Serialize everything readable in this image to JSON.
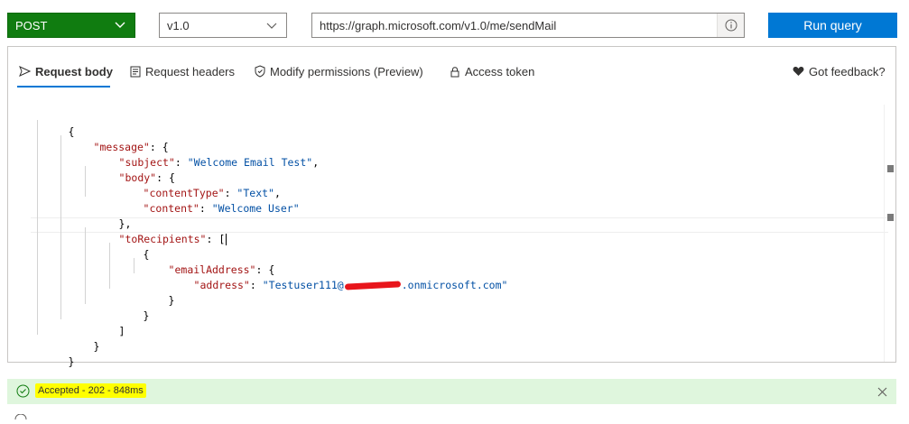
{
  "toolbar": {
    "method": "POST",
    "method_icon": "chevron-down-icon",
    "version": "v1.0",
    "url": "https://graph.microsoft.com/v1.0/me/sendMail",
    "url_info_icon": "info-icon",
    "run_label": "Run query"
  },
  "tabs": [
    {
      "label": "Request body",
      "icon": "send-icon",
      "active": true
    },
    {
      "label": "Request headers",
      "icon": "document-icon",
      "active": false
    },
    {
      "label": "Modify permissions (Preview)",
      "icon": "shield-icon",
      "active": false
    },
    {
      "label": "Access token",
      "icon": "lock-icon",
      "active": false
    }
  ],
  "feedback_label": "Got feedback?",
  "editor": {
    "l1": "{",
    "l2_key": "\"message\"",
    "l2_rest": ": {",
    "l3_key": "\"subject\"",
    "l3_sep": ": ",
    "l3_val": "\"Welcome Email Test\"",
    "l3_end": ",",
    "l4_key": "\"body\"",
    "l4_rest": ": {",
    "l5_key": "\"contentType\"",
    "l5_sep": ": ",
    "l5_val": "\"Text\"",
    "l5_end": ",",
    "l6_key": "\"content\"",
    "l6_sep": ": ",
    "l6_val": "\"Welcome User\"",
    "l7": "},",
    "l8_key": "\"toRecipients\"",
    "l8_rest": ": [",
    "l9": "{",
    "l10_key": "\"emailAddress\"",
    "l10_rest": ": {",
    "l11_key": "\"address\"",
    "l11_sep": ": ",
    "l11_val_start": "\"Testuser111@",
    "l11_val_end": ".onmicrosoft.com\"",
    "l12": "}",
    "l13": "}",
    "l14": "]",
    "l15": "}",
    "l16": "}"
  },
  "status": {
    "text": "Accepted - 202 - 848ms",
    "background": "#dff6dd",
    "highlight": "#ffff00"
  },
  "colors": {
    "method_bg": "#107c10",
    "run_bg": "#0078d4",
    "accent": "#0078d4",
    "json_key": "#a31515",
    "json_string": "#0451a5"
  }
}
